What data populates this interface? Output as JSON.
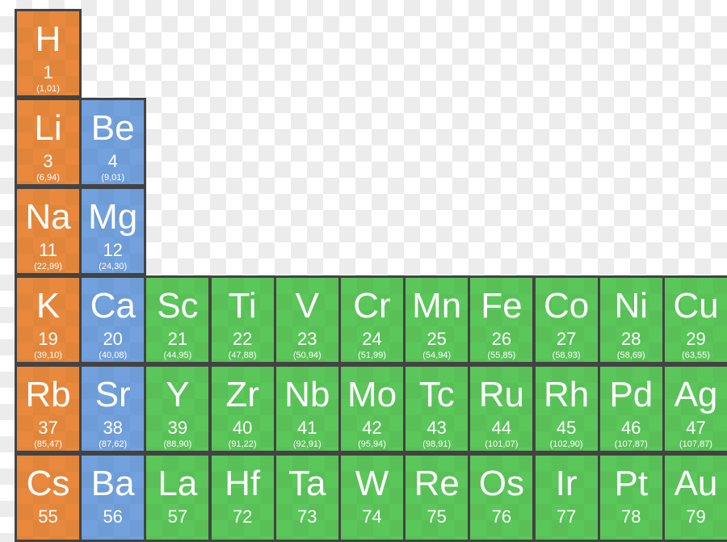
{
  "colors": {
    "alkali_metal": "#e8893d",
    "alkaline_earth_metal": "#72a1dd",
    "transition_metal": "#5bc65a",
    "border": "#434343"
  },
  "elements": [
    {
      "symbol": "H",
      "number": "1",
      "mass": "(1,01)",
      "period": 1,
      "group": 1,
      "category": "alkali_metal"
    },
    {
      "symbol": "Li",
      "number": "3",
      "mass": "(6,94)",
      "period": 2,
      "group": 1,
      "category": "alkali_metal"
    },
    {
      "symbol": "Be",
      "number": "4",
      "mass": "(9,01)",
      "period": 2,
      "group": 2,
      "category": "alkaline_earth_metal"
    },
    {
      "symbol": "Na",
      "number": "11",
      "mass": "(22,99)",
      "period": 3,
      "group": 1,
      "category": "alkali_metal"
    },
    {
      "symbol": "Mg",
      "number": "12",
      "mass": "(24,30)",
      "period": 3,
      "group": 2,
      "category": "alkaline_earth_metal"
    },
    {
      "symbol": "K",
      "number": "19",
      "mass": "(39,10)",
      "period": 4,
      "group": 1,
      "category": "alkali_metal"
    },
    {
      "symbol": "Ca",
      "number": "20",
      "mass": "(40,08)",
      "period": 4,
      "group": 2,
      "category": "alkaline_earth_metal"
    },
    {
      "symbol": "Sc",
      "number": "21",
      "mass": "(44,95)",
      "period": 4,
      "group": 3,
      "category": "transition_metal"
    },
    {
      "symbol": "Ti",
      "number": "22",
      "mass": "(47,88)",
      "period": 4,
      "group": 4,
      "category": "transition_metal"
    },
    {
      "symbol": "V",
      "number": "23",
      "mass": "(50,94)",
      "period": 4,
      "group": 5,
      "category": "transition_metal"
    },
    {
      "symbol": "Cr",
      "number": "24",
      "mass": "(51,99)",
      "period": 4,
      "group": 6,
      "category": "transition_metal"
    },
    {
      "symbol": "Mn",
      "number": "25",
      "mass": "(54,94)",
      "period": 4,
      "group": 7,
      "category": "transition_metal"
    },
    {
      "symbol": "Fe",
      "number": "26",
      "mass": "(55,85)",
      "period": 4,
      "group": 8,
      "category": "transition_metal"
    },
    {
      "symbol": "Co",
      "number": "27",
      "mass": "(58,93)",
      "period": 4,
      "group": 9,
      "category": "transition_metal"
    },
    {
      "symbol": "Ni",
      "number": "28",
      "mass": "(58,69)",
      "period": 4,
      "group": 10,
      "category": "transition_metal"
    },
    {
      "symbol": "Cu",
      "number": "29",
      "mass": "(63,55)",
      "period": 4,
      "group": 11,
      "category": "transition_metal"
    },
    {
      "symbol": "Rb",
      "number": "37",
      "mass": "(85,47)",
      "period": 5,
      "group": 1,
      "category": "alkali_metal"
    },
    {
      "symbol": "Sr",
      "number": "38",
      "mass": "(87,62)",
      "period": 5,
      "group": 2,
      "category": "alkaline_earth_metal"
    },
    {
      "symbol": "Y",
      "number": "39",
      "mass": "(88,90)",
      "period": 5,
      "group": 3,
      "category": "transition_metal"
    },
    {
      "symbol": "Zr",
      "number": "40",
      "mass": "(91,22)",
      "period": 5,
      "group": 4,
      "category": "transition_metal"
    },
    {
      "symbol": "Nb",
      "number": "41",
      "mass": "(92,91)",
      "period": 5,
      "group": 5,
      "category": "transition_metal"
    },
    {
      "symbol": "Mo",
      "number": "42",
      "mass": "(95,94)",
      "period": 5,
      "group": 6,
      "category": "transition_metal"
    },
    {
      "symbol": "Tc",
      "number": "43",
      "mass": "(98,91)",
      "period": 5,
      "group": 7,
      "category": "transition_metal"
    },
    {
      "symbol": "Ru",
      "number": "44",
      "mass": "(101,07)",
      "period": 5,
      "group": 8,
      "category": "transition_metal"
    },
    {
      "symbol": "Rh",
      "number": "45",
      "mass": "(102,90)",
      "period": 5,
      "group": 9,
      "category": "transition_metal"
    },
    {
      "symbol": "Pd",
      "number": "46",
      "mass": "(107,87)",
      "period": 5,
      "group": 10,
      "category": "transition_metal"
    },
    {
      "symbol": "Ag",
      "number": "47",
      "mass": "(107,87)",
      "period": 5,
      "group": 11,
      "category": "transition_metal"
    },
    {
      "symbol": "Cs",
      "number": "55",
      "period": 6,
      "group": 1,
      "category": "alkali_metal"
    },
    {
      "symbol": "Ba",
      "number": "56",
      "period": 6,
      "group": 2,
      "category": "alkaline_earth_metal"
    },
    {
      "symbol": "La",
      "number": "57",
      "period": 6,
      "group": 3,
      "category": "transition_metal"
    },
    {
      "symbol": "Hf",
      "number": "72",
      "period": 6,
      "group": 4,
      "category": "transition_metal"
    },
    {
      "symbol": "Ta",
      "number": "73",
      "period": 6,
      "group": 5,
      "category": "transition_metal"
    },
    {
      "symbol": "W",
      "number": "74",
      "period": 6,
      "group": 6,
      "category": "transition_metal"
    },
    {
      "symbol": "Re",
      "number": "75",
      "period": 6,
      "group": 7,
      "category": "transition_metal"
    },
    {
      "symbol": "Os",
      "number": "76",
      "period": 6,
      "group": 8,
      "category": "transition_metal"
    },
    {
      "symbol": "Ir",
      "number": "77",
      "period": 6,
      "group": 9,
      "category": "transition_metal"
    },
    {
      "symbol": "Pt",
      "number": "78",
      "period": 6,
      "group": 10,
      "category": "transition_metal"
    },
    {
      "symbol": "Au",
      "number": "79",
      "period": 6,
      "group": 11,
      "category": "transition_metal"
    }
  ]
}
